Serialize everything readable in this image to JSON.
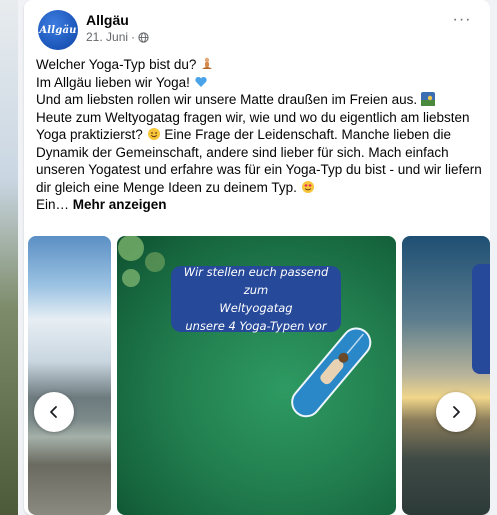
{
  "post": {
    "page_name": "Allgäu",
    "avatar_text": "Allgäu",
    "date": "21. Juni",
    "meta_separator": "·",
    "audience_icon": "globe-icon",
    "more_label": "···",
    "text_lines": [
      "Welcher Yoga-Typ bist du?",
      "Im Allgäu lieben wir Yoga!",
      "Und am liebsten rollen wir unsere Matte draußen im Freien aus.",
      "Heute zum Weltyogatag fragen wir, wie und wo du eigentlich am liebsten Yoga praktizierst?",
      "Eine Frage der Leidenschaft. Manche lieben die Dynamik der Gemeinschaft, andere sind lieber für sich. Mach einfach unseren Yogatest und erfahre was für ein Yoga-Typ du bist - und wir liefern dir gleich eine Menge Ideen zu deinem Typ.",
      "Ein…"
    ],
    "see_more": "Mehr anzeigen"
  },
  "carousel": {
    "caption_lines": [
      "Wir stellen euch passend zum",
      "Weltyogatag",
      "unsere 4 Yoga-Typen vor"
    ],
    "prev_icon": "chevron-left-icon",
    "next_icon": "chevron-right-icon"
  },
  "colors": {
    "brand_blue": "#27499a",
    "meta_gray": "#65676b"
  }
}
